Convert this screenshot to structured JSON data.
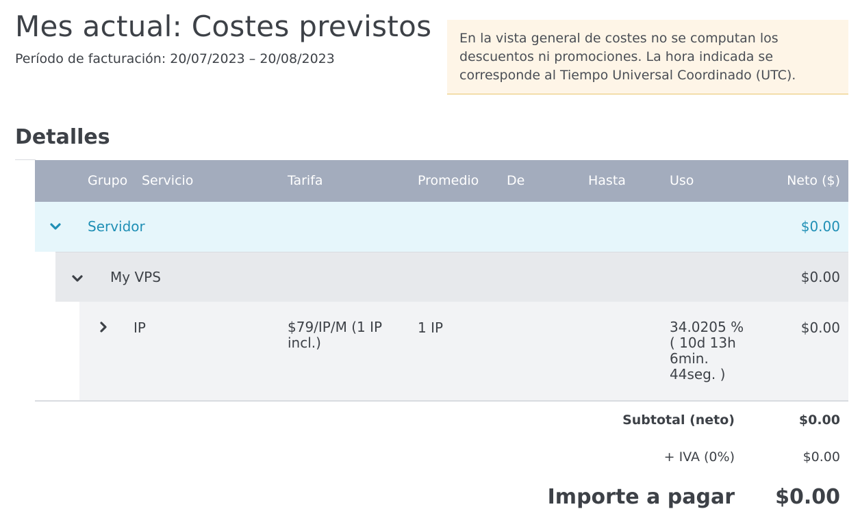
{
  "header": {
    "title": "Mes actual: Costes previstos",
    "billing_period": "Período de facturación: 20/07/2023 – 20/08/2023"
  },
  "notice": {
    "text": "En la vista general de costes no se computan los descuentos ni promociones. La hora indicada se corresponde al Tiempo Universal Coordinado (UTC)."
  },
  "details": {
    "title": "Detalles",
    "columns": {
      "group": "Grupo",
      "service": "Servicio",
      "tariff": "Tarifa",
      "average": "Promedio",
      "from": "De",
      "to": "Hasta",
      "usage": "Uso",
      "net": "Neto ($)"
    },
    "group_row": {
      "label": "Servidor",
      "net": "$0.00",
      "icon": "chevron-down-icon"
    },
    "server_row": {
      "label": "My VPS",
      "net": "$0.00",
      "icon": "chevron-down-icon"
    },
    "item_row": {
      "service": "IP",
      "tariff": "$79/IP/M (1 IP incl.)",
      "average": "1 IP",
      "usage": "34.0205 % ( 10d 13h 6min. 44seg. )",
      "net": "$0.00",
      "icon": "chevron-right-icon"
    }
  },
  "totals": {
    "subtotal_label": "Subtotal (neto)",
    "subtotal_value": "$0.00",
    "vat_label": "+ IVA (0%)",
    "vat_value": "$0.00",
    "due_label": "Importe a pagar",
    "due_value": "$0.00"
  },
  "colors": {
    "header_bg": "#a3acbd",
    "group_bg": "#e6f6fb",
    "group_text": "#1f8fb5",
    "notice_bg": "#fef5e7"
  }
}
